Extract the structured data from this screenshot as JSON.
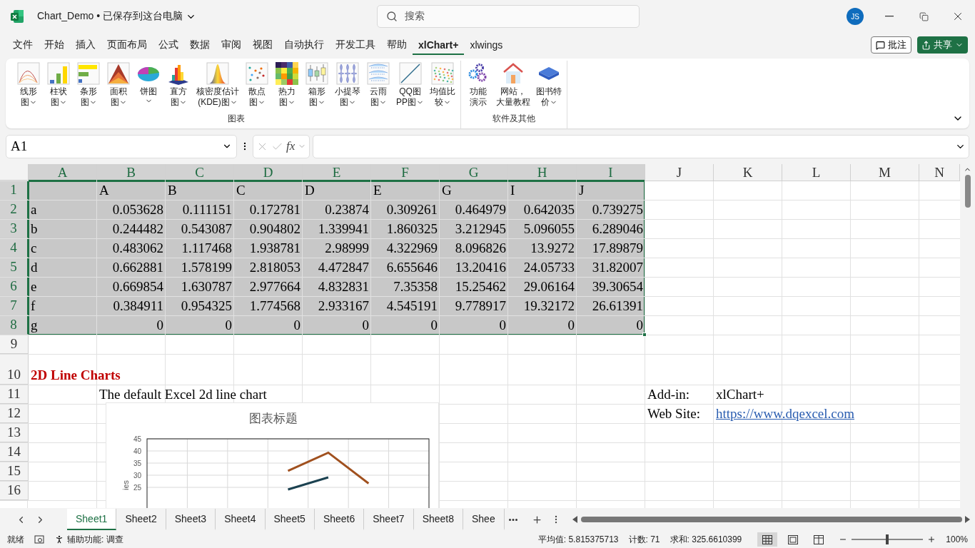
{
  "window": {
    "title": "Chart_Demo • 已保存到这台电脑",
    "search_placeholder": "搜索",
    "avatar": "JS"
  },
  "ribbon_tabs": [
    {
      "label": "文件",
      "selected": false
    },
    {
      "label": "开始",
      "selected": false
    },
    {
      "label": "插入",
      "selected": false
    },
    {
      "label": "页面布局",
      "selected": false
    },
    {
      "label": "公式",
      "selected": false
    },
    {
      "label": "数据",
      "selected": false
    },
    {
      "label": "审阅",
      "selected": false
    },
    {
      "label": "视图",
      "selected": false
    },
    {
      "label": "自动执行",
      "selected": false
    },
    {
      "label": "开发工具",
      "selected": false
    },
    {
      "label": "帮助",
      "selected": false
    },
    {
      "label": "xlChart+",
      "selected": true
    },
    {
      "label": "xlwings",
      "selected": false
    }
  ],
  "ribbon_actions": {
    "comments": "批注",
    "share": "共享"
  },
  "ribbon_groups": [
    {
      "title": "图表",
      "buttons": [
        {
          "label": [
            "线形",
            "图"
          ],
          "dropdown": true
        },
        {
          "label": [
            "柱状",
            "图"
          ],
          "dropdown": true
        },
        {
          "label": [
            "条形",
            "图"
          ],
          "dropdown": true
        },
        {
          "label": [
            "面积",
            "图"
          ],
          "dropdown": true
        },
        {
          "label": [
            "饼图"
          ],
          "dropdown": true
        },
        {
          "label": [
            "直方",
            "图"
          ],
          "dropdown": true
        },
        {
          "label": [
            "核密度估计",
            "(KDE)图"
          ],
          "dropdown": true
        },
        {
          "label": [
            "散点",
            "图"
          ],
          "dropdown": true
        },
        {
          "label": [
            "热力",
            "图"
          ],
          "dropdown": true
        },
        {
          "label": [
            "箱形",
            "图"
          ],
          "dropdown": true
        },
        {
          "label": [
            "小提琴",
            "图"
          ],
          "dropdown": true
        },
        {
          "label": [
            "云雨",
            "图"
          ],
          "dropdown": true
        },
        {
          "label": [
            "QQ图",
            "PP图"
          ],
          "dropdown": true
        },
        {
          "label": [
            "均值比",
            "较"
          ],
          "dropdown": true
        }
      ]
    },
    {
      "title": "软件及其他",
      "buttons": [
        {
          "label": [
            "功能",
            "演示"
          ],
          "dropdown": false
        },
        {
          "label": [
            "网站，",
            "大量教程"
          ],
          "dropdown": false
        },
        {
          "label": [
            "图书特",
            "价"
          ],
          "dropdown": true
        }
      ]
    }
  ],
  "formula_bar": {
    "name_box": "A1",
    "function_label": "fx"
  },
  "sheet": {
    "columns": [
      {
        "label": "A",
        "selected": true
      },
      {
        "label": "B",
        "selected": true
      },
      {
        "label": "C",
        "selected": true
      },
      {
        "label": "D",
        "selected": true
      },
      {
        "label": "E",
        "selected": true
      },
      {
        "label": "F",
        "selected": true
      },
      {
        "label": "G",
        "selected": true
      },
      {
        "label": "H",
        "selected": true
      },
      {
        "label": "I",
        "selected": true
      },
      {
        "label": "J",
        "selected": false
      },
      {
        "label": "K",
        "selected": false
      },
      {
        "label": "L",
        "selected": false
      },
      {
        "label": "M",
        "selected": false
      },
      {
        "label": "N",
        "selected": false
      }
    ],
    "rows": [
      {
        "number": "1",
        "selected": true,
        "cells": [
          {
            "kind": "empty"
          },
          {
            "kind": "text",
            "text": "A"
          },
          {
            "kind": "text",
            "text": "B"
          },
          {
            "kind": "text",
            "text": "C"
          },
          {
            "kind": "text",
            "text": "D"
          },
          {
            "kind": "text",
            "text": "E"
          },
          {
            "kind": "text",
            "text": "G"
          },
          {
            "kind": "text",
            "text": "I"
          },
          {
            "kind": "text",
            "text": "J"
          }
        ]
      },
      {
        "number": "2",
        "selected": true,
        "cells": [
          {
            "kind": "text",
            "text": "a"
          },
          {
            "kind": "number",
            "text": "0.053628"
          },
          {
            "kind": "number",
            "text": "0.111151"
          },
          {
            "kind": "number",
            "text": "0.172781"
          },
          {
            "kind": "number",
            "text": "0.23874"
          },
          {
            "kind": "number",
            "text": "0.309261"
          },
          {
            "kind": "number",
            "text": "0.464979"
          },
          {
            "kind": "number",
            "text": "0.642035"
          },
          {
            "kind": "number",
            "text": "0.739275"
          }
        ]
      },
      {
        "number": "3",
        "selected": true,
        "cells": [
          {
            "kind": "text",
            "text": "b"
          },
          {
            "kind": "number",
            "text": "0.244482"
          },
          {
            "kind": "number",
            "text": "0.543087"
          },
          {
            "kind": "number",
            "text": "0.904802"
          },
          {
            "kind": "number",
            "text": "1.339941"
          },
          {
            "kind": "number",
            "text": "1.860325"
          },
          {
            "kind": "number",
            "text": "3.212945"
          },
          {
            "kind": "number",
            "text": "5.096055"
          },
          {
            "kind": "number",
            "text": "6.289046"
          }
        ]
      },
      {
        "number": "4",
        "selected": true,
        "cells": [
          {
            "kind": "text",
            "text": "c"
          },
          {
            "kind": "number",
            "text": "0.483062"
          },
          {
            "kind": "number",
            "text": "1.117468"
          },
          {
            "kind": "number",
            "text": "1.938781"
          },
          {
            "kind": "number",
            "text": "2.98999"
          },
          {
            "kind": "number",
            "text": "4.322969"
          },
          {
            "kind": "number",
            "text": "8.096826"
          },
          {
            "kind": "number",
            "text": "13.9272"
          },
          {
            "kind": "number",
            "text": "17.89879"
          }
        ]
      },
      {
        "number": "5",
        "selected": true,
        "cells": [
          {
            "kind": "text",
            "text": "d"
          },
          {
            "kind": "number",
            "text": "0.662881"
          },
          {
            "kind": "number",
            "text": "1.578199"
          },
          {
            "kind": "number",
            "text": "2.818053"
          },
          {
            "kind": "number",
            "text": "4.472847"
          },
          {
            "kind": "number",
            "text": "6.655646"
          },
          {
            "kind": "number",
            "text": "13.20416"
          },
          {
            "kind": "number",
            "text": "24.05733"
          },
          {
            "kind": "number",
            "text": "31.82007"
          }
        ]
      },
      {
        "number": "6",
        "selected": true,
        "cells": [
          {
            "kind": "text",
            "text": "e"
          },
          {
            "kind": "number",
            "text": "0.669854"
          },
          {
            "kind": "number",
            "text": "1.630787"
          },
          {
            "kind": "number",
            "text": "2.977664"
          },
          {
            "kind": "number",
            "text": "4.832831"
          },
          {
            "kind": "number",
            "text": "7.35358"
          },
          {
            "kind": "number",
            "text": "15.25462"
          },
          {
            "kind": "number",
            "text": "29.06164"
          },
          {
            "kind": "number",
            "text": "39.30654"
          }
        ]
      },
      {
        "number": "7",
        "selected": true,
        "cells": [
          {
            "kind": "text",
            "text": "f"
          },
          {
            "kind": "number",
            "text": "0.384911"
          },
          {
            "kind": "number",
            "text": "0.954325"
          },
          {
            "kind": "number",
            "text": "1.774568"
          },
          {
            "kind": "number",
            "text": "2.933167"
          },
          {
            "kind": "number",
            "text": "4.545191"
          },
          {
            "kind": "number",
            "text": "9.778917"
          },
          {
            "kind": "number",
            "text": "19.32172"
          },
          {
            "kind": "number",
            "text": "26.61391"
          }
        ]
      },
      {
        "number": "8",
        "selected": true,
        "cells": [
          {
            "kind": "text",
            "text": "g"
          },
          {
            "kind": "number",
            "text": "0"
          },
          {
            "kind": "number",
            "text": "0"
          },
          {
            "kind": "number",
            "text": "0"
          },
          {
            "kind": "number",
            "text": "0"
          },
          {
            "kind": "number",
            "text": "0"
          },
          {
            "kind": "number",
            "text": "0"
          },
          {
            "kind": "number",
            "text": "0"
          },
          {
            "kind": "number",
            "text": "0"
          }
        ]
      },
      {
        "number": "9",
        "selected": false,
        "cells": []
      },
      {
        "number": "10",
        "selected": false,
        "cells": [
          {
            "kind": "title",
            "text": "2D Line Charts"
          }
        ]
      },
      {
        "number": "11",
        "selected": false,
        "cells": [
          {
            "kind": "empty"
          },
          {
            "kind": "text",
            "text": "The default Excel 2d line chart"
          },
          {
            "kind": "empty"
          },
          {
            "kind": "empty"
          },
          {
            "kind": "empty"
          },
          {
            "kind": "empty"
          },
          {
            "kind": "empty"
          },
          {
            "kind": "empty"
          },
          {
            "kind": "empty"
          },
          {
            "kind": "text",
            "text": "Add-in:"
          },
          {
            "kind": "text",
            "text": "xlChart+"
          }
        ]
      },
      {
        "number": "12",
        "selected": false,
        "cells": [
          {
            "kind": "empty"
          },
          {
            "kind": "empty"
          },
          {
            "kind": "empty"
          },
          {
            "kind": "empty"
          },
          {
            "kind": "empty"
          },
          {
            "kind": "empty"
          },
          {
            "kind": "empty"
          },
          {
            "kind": "empty"
          },
          {
            "kind": "empty"
          },
          {
            "kind": "text",
            "text": "Web Site:"
          },
          {
            "kind": "link",
            "text": "https://www.dqexcel.com"
          }
        ]
      },
      {
        "number": "13",
        "selected": false,
        "cells": []
      },
      {
        "number": "14",
        "selected": false,
        "cells": []
      },
      {
        "number": "15",
        "selected": false,
        "cells": []
      },
      {
        "number": "16",
        "selected": false,
        "cells": []
      }
    ],
    "chart": {
      "chart_data": {
        "type": "line",
        "title": "图表标题",
        "ylabel": "ies",
        "grid": true,
        "series": [
          {
            "color": "#a0501e",
            "values": [
              null,
              null,
              null,
              31.8,
              39.3,
              26.6,
              null
            ]
          },
          {
            "color": "#1b4150",
            "values": [
              null,
              null,
              null,
              24.1,
              29.1,
              null,
              null
            ]
          }
        ],
        "ylim": [
          0,
          45
        ],
        "yticks": [
          25,
          30,
          35,
          40,
          45
        ]
      }
    }
  },
  "sheet_tabs": [
    {
      "label": "Sheet1",
      "selected": true
    },
    {
      "label": "Sheet2",
      "selected": false
    },
    {
      "label": "Sheet3",
      "selected": false
    },
    {
      "label": "Sheet4",
      "selected": false
    },
    {
      "label": "Sheet5",
      "selected": false
    },
    {
      "label": "Sheet6",
      "selected": false
    },
    {
      "label": "Sheet7",
      "selected": false
    },
    {
      "label": "Sheet8",
      "selected": false
    },
    {
      "label": "Shee",
      "selected": false
    }
  ],
  "status_bar": {
    "mode": "就绪",
    "accessibility": "辅助功能: 调查",
    "stats": [
      "平均值: 5.815375713",
      "计数: 71",
      "求和: 325.6610399"
    ],
    "views": [
      {
        "selected": true
      },
      {
        "selected": false
      },
      {
        "selected": false
      }
    ],
    "zoom": {
      "level": 0.5,
      "label": "100%"
    }
  }
}
